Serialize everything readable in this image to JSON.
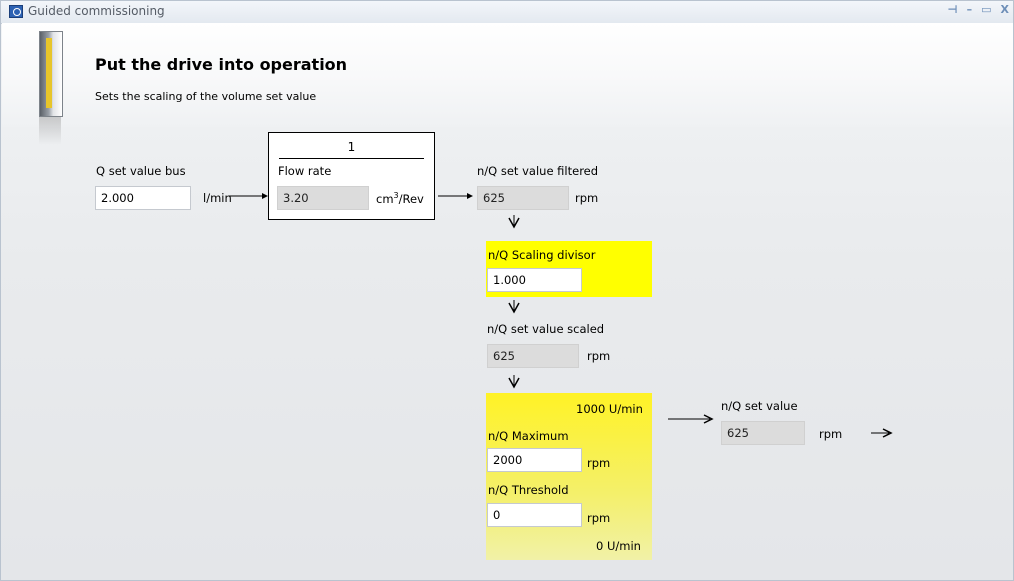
{
  "window": {
    "title": "Guided commissioning",
    "buttons": [
      "pin-icon",
      "minimize-icon",
      "maximize-icon",
      "close-icon"
    ]
  },
  "header": {
    "title": "Put the drive into operation",
    "subtitle": "Sets the scaling of the volume set value"
  },
  "flow": {
    "q_set_value_bus": {
      "label": "Q set value bus",
      "value": "2.000",
      "unit": "l/min"
    },
    "flow_rate_box": {
      "number": "1",
      "label": "Flow rate",
      "value": "3.20",
      "unit_base": "cm",
      "unit_exp": "3",
      "unit_tail": "/Rev"
    },
    "filtered": {
      "label": "n/Q set value filtered",
      "value": "625",
      "unit": "rpm"
    },
    "scaling_divisor": {
      "label": "n/Q Scaling divisor",
      "value": "1.000"
    },
    "scaled": {
      "label": "n/Q set value scaled",
      "value": "625",
      "unit": "rpm"
    },
    "limits": {
      "top_label": "1000 U/min",
      "maximum": {
        "label": "n/Q Maximum",
        "value": "2000",
        "unit": "rpm"
      },
      "threshold": {
        "label": "n/Q Threshold",
        "value": "0",
        "unit": "rpm"
      },
      "bottom_label": "0 U/min"
    },
    "set_value": {
      "label": "n/Q set value",
      "value": "625",
      "unit": "rpm"
    }
  },
  "colors": {
    "highlight": "#ffff00",
    "readonly_field": "#dcdcdc",
    "titlebar_text": "#555c66"
  }
}
